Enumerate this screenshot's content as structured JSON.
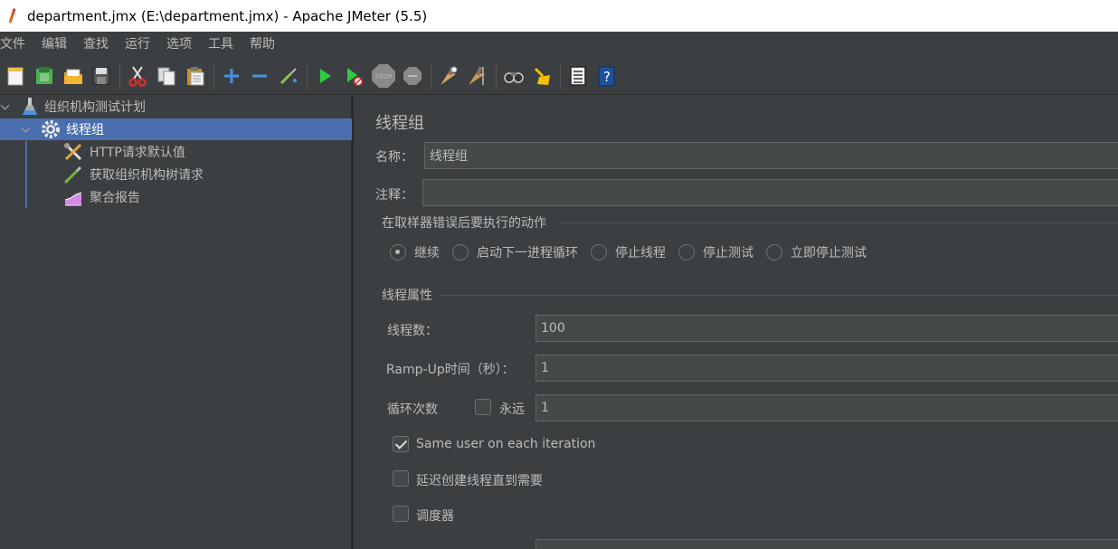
{
  "window": {
    "title": "department.jmx (E:\\department.jmx) - Apache JMeter (5.5)"
  },
  "menu": [
    "文件",
    "编辑",
    "查找",
    "运行",
    "选项",
    "工具",
    "帮助"
  ],
  "toolbar": {
    "icons": [
      "new-icon",
      "templates-icon",
      "open-icon",
      "save-icon",
      "cut-icon",
      "copy-icon",
      "paste-icon",
      "expand-icon",
      "collapse-icon",
      "toggle-icon",
      "start-icon",
      "start-no-pause-icon",
      "stop-icon",
      "shutdown-icon",
      "clear-icon",
      "clear-all-icon",
      "search-icon",
      "reset-search-icon",
      "function-helper-icon",
      "help-icon"
    ]
  },
  "tree": {
    "items": [
      {
        "label": "组织机构测试计划",
        "icon": "test-plan-icon",
        "depth": 0,
        "selected": false
      },
      {
        "label": "线程组",
        "icon": "gear-icon",
        "depth": 1,
        "selected": true
      },
      {
        "label": "HTTP请求默认值",
        "icon": "wrench-icon",
        "depth": 2,
        "selected": false
      },
      {
        "label": "获取组织机构树请求",
        "icon": "pipette-icon",
        "depth": 2,
        "selected": false
      },
      {
        "label": "聚合报告",
        "icon": "chart-icon",
        "depth": 2,
        "selected": false
      }
    ]
  },
  "panel": {
    "title": "线程组",
    "name_label": "名称：",
    "name_value": "线程组",
    "comment_label": "注释：",
    "comment_value": "",
    "error_action": {
      "title": "在取样器错误后要执行的动作",
      "options": [
        "继续",
        "启动下一进程循环",
        "停止线程",
        "停止测试",
        "立即停止测试"
      ],
      "selected": "继续"
    },
    "thread_props": {
      "title": "线程属性",
      "threads_label": "线程数：",
      "threads_value": "100",
      "rampup_label": "Ramp-Up时间（秒）：",
      "rampup_value": "1",
      "loop_label": "循环次数",
      "forever_label": "永远",
      "forever_checked": false,
      "loop_value": "1",
      "same_user_label": "Same user on each iteration",
      "same_user_checked": true,
      "delay_label": "延迟创建线程直到需要",
      "delay_checked": false,
      "scheduler_label": "调度器",
      "scheduler_checked": false
    }
  }
}
